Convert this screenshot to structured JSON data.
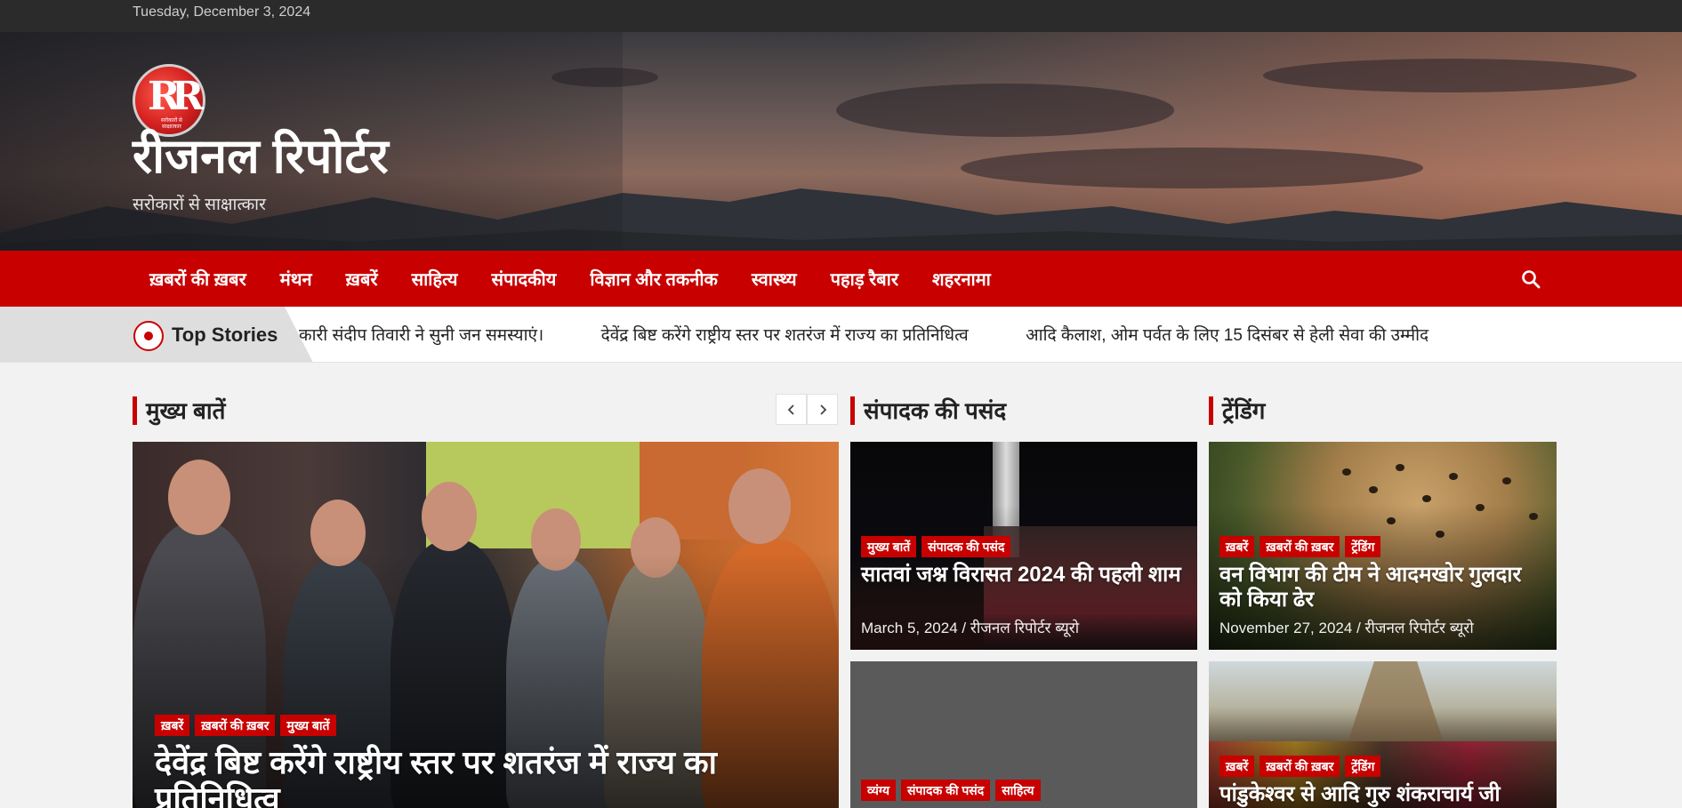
{
  "topbar": {
    "date": "Tuesday, December 3, 2024"
  },
  "site": {
    "logo_letters": "RR",
    "logo_caption": "सरोकारों से साक्षात्कार",
    "title": "रीजनल रिपोर्टर",
    "tagline": "सरोकारों से साक्षात्कार"
  },
  "nav": {
    "items": [
      {
        "label": "ख़बरों की ख़बर"
      },
      {
        "label": "मंथन"
      },
      {
        "label": "ख़बरें"
      },
      {
        "label": "साहित्य"
      },
      {
        "label": "संपादकीय"
      },
      {
        "label": "विज्ञान और तकनीक"
      },
      {
        "label": "स्वास्थ्य"
      },
      {
        "label": "पहाड़ रैबार"
      },
      {
        "label": "शहरनामा"
      }
    ],
    "search_icon": "search-icon"
  },
  "ticker": {
    "label": "Top Stories",
    "items": [
      "कारी संदीप तिवारी ने सुनी जन समस्याएं।",
      "देवेंद्र बिष्ट करेंगे राष्ट्रीय स्तर पर शतरंज में राज्य का प्रतिनिधित्व",
      "आदि कैलाश, ओम पर्वत के लिए 15 दिसंबर से हेली सेवा की उम्मीद"
    ]
  },
  "sections": {
    "main": {
      "heading": "मुख्य बातें",
      "prev_icon": "chevron-left-icon",
      "next_icon": "chevron-right-icon"
    },
    "editor": {
      "heading": "संपादक की पसंद"
    },
    "trending": {
      "heading": "ट्रेंडिंग"
    }
  },
  "featured": {
    "cats": [
      "ख़बरें",
      "ख़बरों की ख़बर",
      "मुख्य बातें"
    ],
    "title": "देवेंद्र बिष्ट करेंगे राष्ट्रीय स्तर पर शतरंज में राज्य का प्रतिनिधित्व"
  },
  "editor_cards": [
    {
      "cats": [
        "मुख्य बातें",
        "संपादक की पसंद"
      ],
      "title": "सातवां जश्न विरासत 2024 की पहली शाम",
      "date": "March 5, 2024",
      "author": "रीजनल रिपोर्टर ब्यूरो"
    },
    {
      "cats": [
        "व्यंग्य",
        "संपादक की पसंद",
        "साहित्य"
      ]
    }
  ],
  "trending_cards": [
    {
      "cats": [
        "ख़बरें",
        "ख़बरों की ख़बर",
        "ट्रेंडिंग"
      ],
      "title": "वन विभाग की टीम ने आदमखोर गुलदार को किया ढेर",
      "date": "November 27, 2024",
      "author": "रीजनल रिपोर्टर ब्यूरो"
    },
    {
      "cats": [
        "ख़बरें",
        "ख़बरों की ख़बर",
        "ट्रेंडिंग"
      ],
      "title": "पांडुकेश्वर से आदि गुरु शंकराचार्य जी"
    }
  ],
  "meta_separator": "/"
}
